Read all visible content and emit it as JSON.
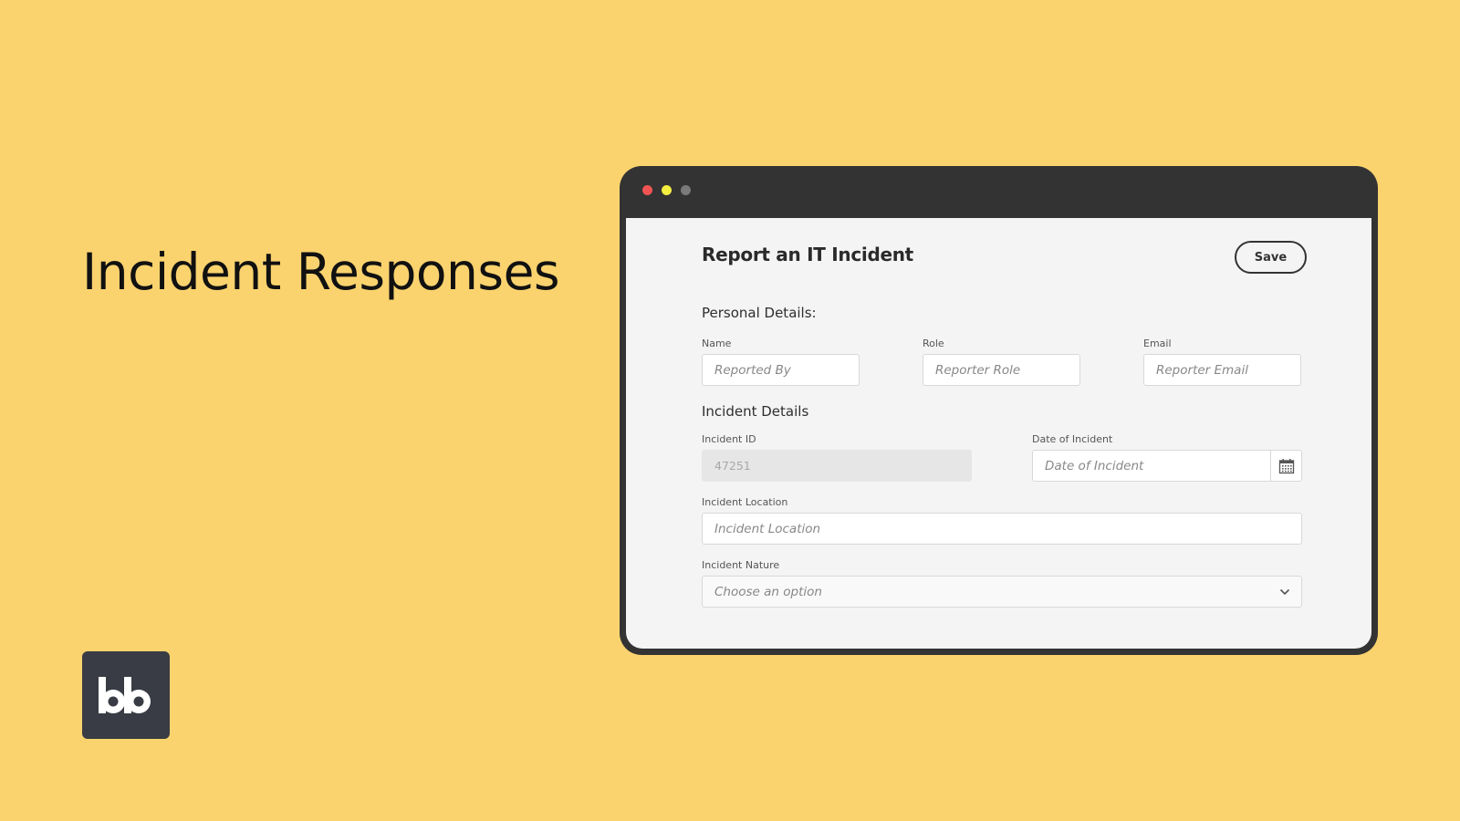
{
  "hero": {
    "title": "Incident Responses"
  },
  "logo": {
    "text": "bb",
    "icon": "budibase-logo-icon"
  },
  "window": {
    "controls": [
      "close-dot",
      "minimize-dot",
      "maximize-dot"
    ],
    "colors": {
      "close": "#F25454",
      "minimize": "#F4EE3F",
      "maximize": "#7A7A7A",
      "frame": "#333333",
      "background": "#FAD36E"
    }
  },
  "form": {
    "title": "Report an IT Incident",
    "save_label": "Save",
    "personal_section": "Personal Details:",
    "incident_section": "Incident Details",
    "fields": {
      "name": {
        "label": "Name",
        "placeholder": "Reported By"
      },
      "role": {
        "label": "Role",
        "placeholder": "Reporter Role"
      },
      "email": {
        "label": "Email",
        "placeholder": "Reporter Email"
      },
      "incident_id": {
        "label": "Incident ID",
        "value": "47251"
      },
      "date": {
        "label": "Date of Incident",
        "placeholder": "Date of Incident",
        "icon": "calendar-icon"
      },
      "location": {
        "label": "Incident Location",
        "placeholder": "Incident Location"
      },
      "nature": {
        "label": "Incident Nature",
        "placeholder": "Choose an option",
        "icon": "chevron-down-icon"
      }
    }
  }
}
